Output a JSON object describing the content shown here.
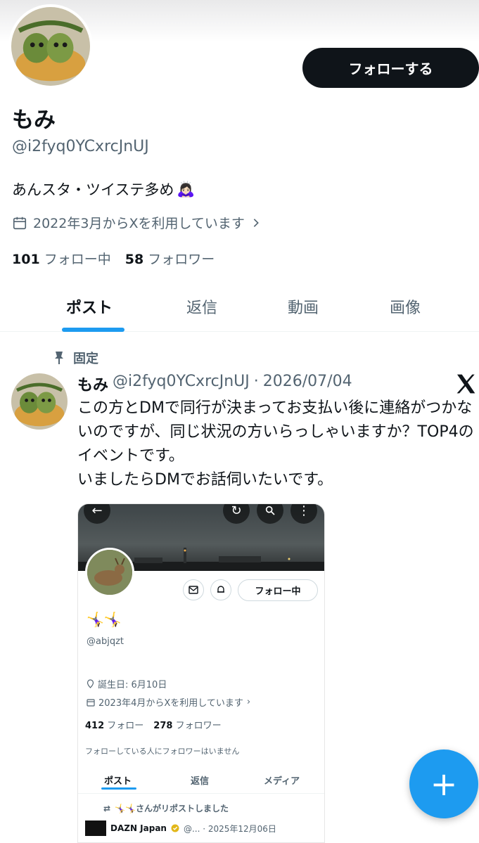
{
  "profile": {
    "follow_button": "フォローする",
    "display_name": "もみ",
    "handle": "@i2fyq0YCxrcJnUJ",
    "bio": "あんスタ・ツイステ多め",
    "bio_emoji": "🙇🏻‍♀️",
    "joined": "2022年3月からXを利用しています",
    "following_count": "101",
    "following_label": "フォロー中",
    "followers_count": "58",
    "followers_label": "フォロワー"
  },
  "tabs": [
    "ポスト",
    "返信",
    "動画",
    "画像"
  ],
  "pinned_post": {
    "pinned_label": "固定",
    "name": "もみ",
    "handle": "@i2fyq0YCxrcJnUJ",
    "separator": "·",
    "date": "2026/07/04",
    "text": "この方とDMで同行が決まってお支払い後に連絡がつかないのですが、同じ状況の方いらっしゃいますか？TOP4のイベントです。\nいましたらDMでお話伺いたいです。",
    "screenshot": {
      "follow_button": "フォロー中",
      "name": "🤸‍♀️🤸‍♀️",
      "handle": "@abjqzt",
      "birthday": "誕生日: 6月10日",
      "joined": "2023年4月からXを利用しています",
      "following_count": "412",
      "following_label": "フォロー",
      "followers_count": "278",
      "followers_label": "フォロワー",
      "note": "フォローしている人にフォロワーはいません",
      "tabs": [
        "ポスト",
        "返信",
        "メディア"
      ],
      "repost_text": "🤸‍♀️🤸‍♀️さんがリポストしました",
      "post_name": "DAZN Japan",
      "post_meta": "@...  · 2025年12月06日"
    }
  },
  "fab_label": "+",
  "colors": {
    "accent": "#1d9bf0",
    "text": "#0f1419",
    "secondary": "#536471"
  }
}
